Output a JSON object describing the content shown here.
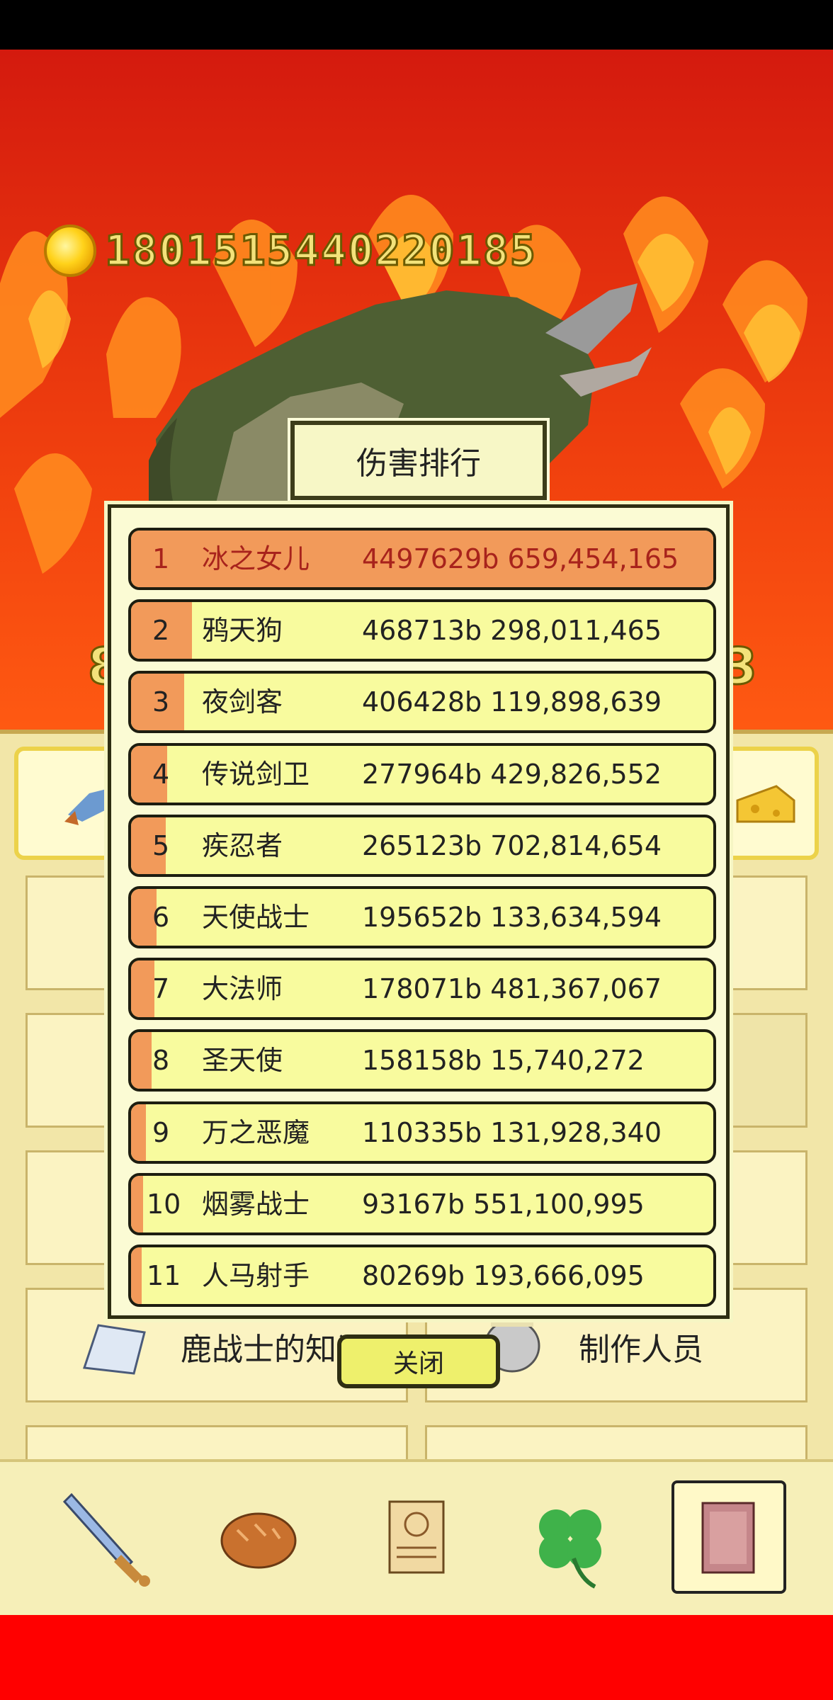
{
  "hud": {
    "coin_amount": "1801515440220185",
    "left_partial": "8",
    "right_partial": "3"
  },
  "ranking": {
    "title": "伤害排行",
    "close_label": "关闭",
    "rows": [
      {
        "rank": "1",
        "name": "冰之女儿",
        "score": "4497629b 659,454,165",
        "fill_fraction": 1.0
      },
      {
        "rank": "2",
        "name": "鸦天狗",
        "score": "468713b 298,011,465",
        "fill_fraction": 0.104
      },
      {
        "rank": "3",
        "name": "夜剑客",
        "score": "406428b 119,898,639",
        "fill_fraction": 0.09
      },
      {
        "rank": "4",
        "name": "传说剑卫",
        "score": "277964b 429,826,552",
        "fill_fraction": 0.062
      },
      {
        "rank": "5",
        "name": "疾忍者",
        "score": "265123b 702,814,654",
        "fill_fraction": 0.059
      },
      {
        "rank": "6",
        "name": "天使战士",
        "score": "195652b 133,634,594",
        "fill_fraction": 0.043
      },
      {
        "rank": "7",
        "name": "大法师",
        "score": "178071b 481,367,067",
        "fill_fraction": 0.04
      },
      {
        "rank": "8",
        "name": "圣天使",
        "score": "158158b 15,740,272",
        "fill_fraction": 0.035
      },
      {
        "rank": "9",
        "name": "万之恶魔",
        "score": "110335b 131,928,340",
        "fill_fraction": 0.025
      },
      {
        "rank": "10",
        "name": "烟雾战士",
        "score": "93167b 551,100,995",
        "fill_fraction": 0.021
      },
      {
        "rank": "11",
        "name": "人马射手",
        "score": "80269b 193,666,095",
        "fill_fraction": 0.018
      }
    ]
  },
  "menu": {
    "knowledge_label": "鹿战士的知识",
    "credits_label": "制作人员"
  },
  "nav": {
    "items": [
      "sword-icon",
      "bread-icon",
      "scroll-icon",
      "clover-icon",
      "book-icon"
    ]
  }
}
